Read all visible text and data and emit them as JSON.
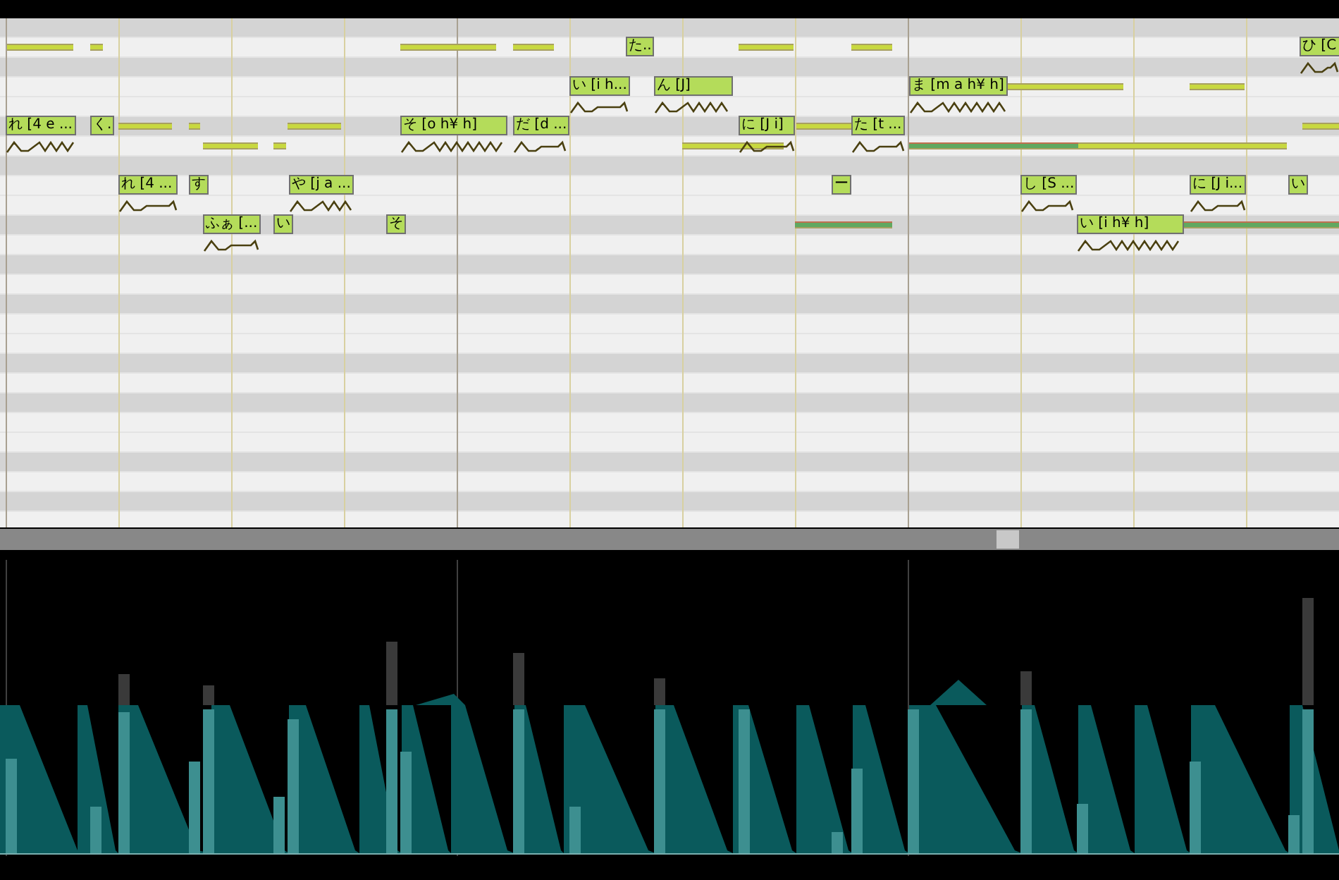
{
  "piano_roll": {
    "notes": [
      {
        "lyric": "た..",
        "pitch_curve": false
      },
      {
        "lyric": "ひ [C",
        "pitch_curve": true
      },
      {
        "lyric": "い [i h...",
        "pitch_curve": true
      },
      {
        "lyric": "ん [J]",
        "pitch_curve": true
      },
      {
        "lyric": "ま [m a h¥ h]",
        "pitch_curve": true
      },
      {
        "lyric": "れ [4 e ...",
        "pitch_curve": true
      },
      {
        "lyric": "く.",
        "pitch_curve": false
      },
      {
        "lyric": "そ [o h¥ h]",
        "pitch_curve": true
      },
      {
        "lyric": "だ [d ...",
        "pitch_curve": true
      },
      {
        "lyric": "に [J i]",
        "pitch_curve": true
      },
      {
        "lyric": "た [t ...",
        "pitch_curve": true
      },
      {
        "lyric": "れ [4 ...",
        "pitch_curve": true
      },
      {
        "lyric": "す",
        "pitch_curve": false
      },
      {
        "lyric": "や [j a ...",
        "pitch_curve": true
      },
      {
        "lyric": "ー",
        "pitch_curve": false
      },
      {
        "lyric": "し [S ...",
        "pitch_curve": true
      },
      {
        "lyric": "に [J i...",
        "pitch_curve": true
      },
      {
        "lyric": "い",
        "pitch_curve": false
      },
      {
        "lyric": "ふぁ [...",
        "pitch_curve": true
      },
      {
        "lyric": "い",
        "pitch_curve": false
      },
      {
        "lyric": "そ",
        "pitch_curve": false
      },
      {
        "lyric": "い [i h¥ h]",
        "pitch_curve": true
      }
    ]
  }
}
